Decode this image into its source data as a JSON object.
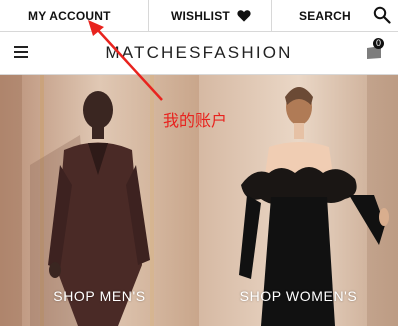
{
  "top_links": {
    "account": "MY ACCOUNT",
    "wishlist": "WISHLIST",
    "search": "SEARCH"
  },
  "brand": "MATCHESFASHION",
  "cart": {
    "count": "0"
  },
  "hero": {
    "mens_label": "SHOP MEN'S",
    "womens_label": "SHOP WOMEN'S"
  },
  "annotation": {
    "text": "我的账户",
    "color": "#e8231e"
  },
  "icons": [
    "heart-icon",
    "search-icon",
    "menu-icon",
    "shopping-bag-icon"
  ]
}
